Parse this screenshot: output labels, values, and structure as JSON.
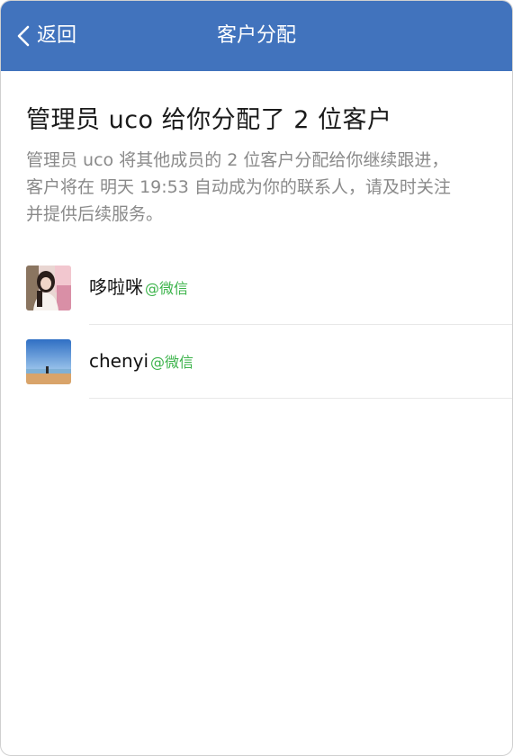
{
  "navbar": {
    "back_label": "返回",
    "title": "客户分配",
    "background_color": "#4173bd"
  },
  "notice": {
    "headline": "管理员 uco 给你分配了 2 位客户",
    "description_lines": [
      "管理员 uco 将其他成员的 2 位客户分配给你继续跟进，",
      "客户将在 明天 19:53 自动成为你的联系人，请及时关注",
      "并提供后续服务。"
    ]
  },
  "customers": [
    {
      "name": "哆啦咪",
      "source": "@微信",
      "avatar": "portrait-photo"
    },
    {
      "name": "chenyi",
      "source": "@微信",
      "avatar": "beach-photo"
    }
  ],
  "colors": {
    "source_tag": "#3bb34a"
  }
}
